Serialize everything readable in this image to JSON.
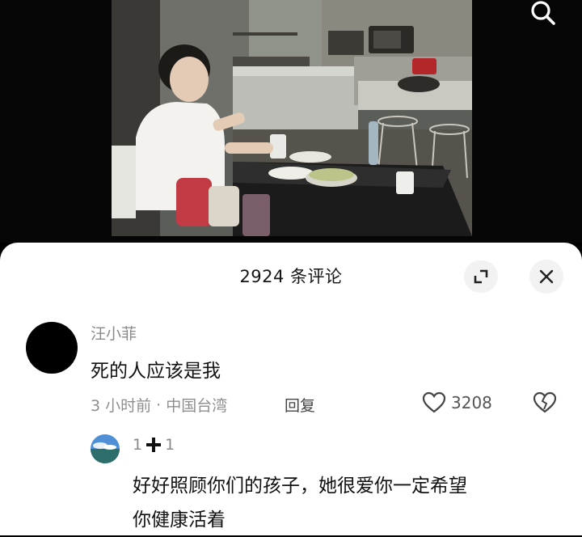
{
  "header": {
    "comment_count": "2924 条评论"
  },
  "icons": {
    "search": "search-icon",
    "expand": "expand-icon",
    "close": "close-icon",
    "like": "heart-icon",
    "dislike": "broken-heart-icon"
  },
  "comment": {
    "username": "汪小菲",
    "text": "死的人应该是我",
    "time": "3 小时前",
    "separator": "·",
    "location": "中国台湾",
    "reply_label": "回复",
    "like_count": "3208"
  },
  "reply": {
    "user_a": "1",
    "user_b": "1",
    "text_line1": "好好照顾你们的孩子，她很爱你一定希望",
    "text_line2": "你健康活着"
  },
  "colors": {
    "panel_bg": "#ffffff",
    "text_primary": "#111111",
    "text_secondary": "#8a8a8a",
    "button_bg": "#f2f2f2"
  }
}
